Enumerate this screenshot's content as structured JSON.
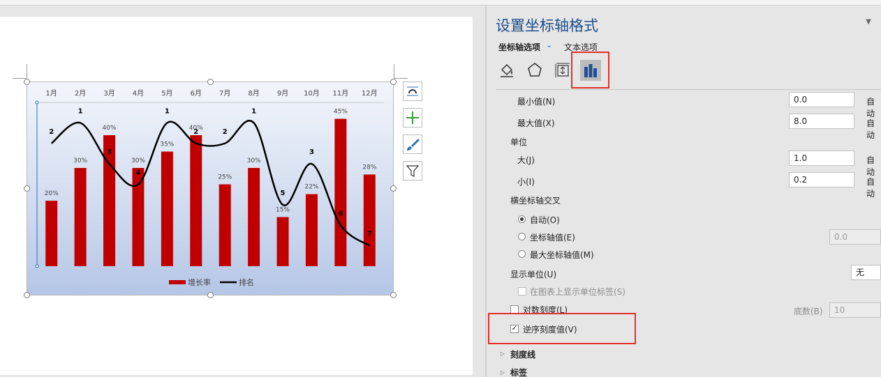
{
  "pane": {
    "title": "设置坐标轴格式",
    "tabs": {
      "axis_options": "坐标轴选项",
      "text_options": "文本选项"
    },
    "icons": [
      "fill-line-icon",
      "effects-icon",
      "size-properties-icon",
      "axis-options-icon"
    ],
    "bounds": {
      "min_label": "最小值(N)",
      "min_value": "0.0",
      "min_auto": "自动",
      "max_label": "最大值(X)",
      "max_value": "8.0",
      "max_auto": "自动"
    },
    "units": {
      "heading": "单位",
      "major_label": "大(J)",
      "major_value": "1.0",
      "major_auto": "自动",
      "minor_label": "小(I)",
      "minor_value": "0.2",
      "minor_auto": "自动"
    },
    "cross": {
      "heading": "横坐标轴交叉",
      "auto_label": "自动(O)",
      "axis_value_label": "坐标轴值(E)",
      "axis_value_value": "0.0",
      "max_axis_label": "最大坐标轴值(M)"
    },
    "display_units": {
      "label": "显示单位(U)",
      "value": "无",
      "show_label": "在图表上显示单位标签(S)"
    },
    "log_scale": {
      "label": "对数刻度(L)",
      "base_label": "底数(B)",
      "base_value": "10"
    },
    "reverse": {
      "label": "逆序刻度值(V)",
      "checked": true
    },
    "sections": {
      "tick_marks": "刻度线",
      "labels": "标签"
    }
  },
  "chart_data": {
    "type": "bar",
    "categories": [
      "1月",
      "2月",
      "3月",
      "4月",
      "5月",
      "6月",
      "7月",
      "8月",
      "9月",
      "10月",
      "11月",
      "12月"
    ],
    "series": [
      {
        "name": "增长率",
        "type": "bar",
        "color": "#c00000",
        "values": [
          0.2,
          0.3,
          0.4,
          0.3,
          0.35,
          0.4,
          0.25,
          0.3,
          0.15,
          0.22,
          0.45,
          0.28
        ],
        "labels": [
          "20%",
          "30%",
          "40%",
          "30%",
          "35%",
          "40%",
          "25%",
          "30%",
          "15%",
          "22%",
          "45%",
          "28%"
        ],
        "ylim": [
          0,
          0.5
        ]
      },
      {
        "name": "排名",
        "type": "line",
        "smooth": true,
        "color": "#000000",
        "values": [
          2,
          1,
          3,
          4,
          1,
          2,
          2,
          1,
          5,
          3,
          6,
          7
        ],
        "labels": [
          "2",
          "1",
          "3",
          "4",
          "1",
          "2",
          "2",
          "1",
          "5",
          "3",
          "6",
          "7"
        ],
        "ylim": [
          0,
          8
        ],
        "reversed": true
      }
    ],
    "legend": "bottom",
    "x_axis_position": "top"
  }
}
